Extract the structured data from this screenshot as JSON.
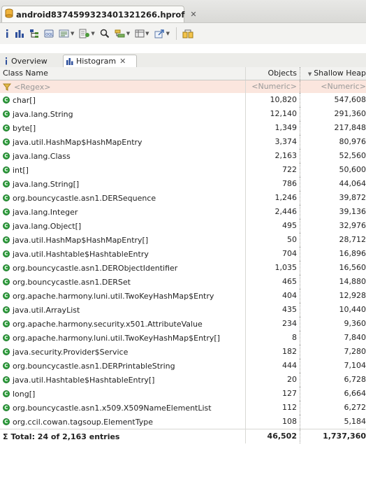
{
  "editor": {
    "file_tab": "android8374599323401321266.hprof",
    "close_glyph": "✕"
  },
  "toolbar": {
    "items": [
      {
        "name": "info-icon",
        "has_dropdown": false
      },
      {
        "name": "histogram-icon",
        "has_dropdown": false
      },
      {
        "name": "dominator-tree-icon",
        "has_dropdown": false
      },
      {
        "name": "oql-icon",
        "has_dropdown": false
      },
      {
        "name": "thread-overview-icon",
        "has_dropdown": true
      },
      {
        "name": "run-report-icon",
        "has_dropdown": true
      },
      {
        "name": "search-icon",
        "has_dropdown": false
      },
      {
        "name": "group-by-icon",
        "has_dropdown": true
      },
      {
        "name": "calculate-retained-icon",
        "has_dropdown": true
      },
      {
        "name": "export-icon",
        "has_dropdown": true
      },
      {
        "name": "compare-icon",
        "has_dropdown": false
      }
    ]
  },
  "subtabs": {
    "overview": "Overview",
    "histogram": "Histogram"
  },
  "table": {
    "headers": {
      "class_name": "Class Name",
      "objects": "Objects",
      "shallow_heap": "Shallow Heap"
    },
    "filter": {
      "regex": "<Regex>",
      "numeric_objects": "<Numeric>",
      "numeric_heap": "<Numeric>"
    },
    "rows": [
      {
        "name": "char[]",
        "objects": "10,820",
        "heap": "547,608"
      },
      {
        "name": "java.lang.String",
        "objects": "12,140",
        "heap": "291,360"
      },
      {
        "name": "byte[]",
        "objects": "1,349",
        "heap": "217,848"
      },
      {
        "name": "java.util.HashMap$HashMapEntry",
        "objects": "3,374",
        "heap": "80,976"
      },
      {
        "name": "java.lang.Class",
        "objects": "2,163",
        "heap": "52,560"
      },
      {
        "name": "int[]",
        "objects": "722",
        "heap": "50,600"
      },
      {
        "name": "java.lang.String[]",
        "objects": "786",
        "heap": "44,064"
      },
      {
        "name": "org.bouncycastle.asn1.DERSequence",
        "objects": "1,246",
        "heap": "39,872"
      },
      {
        "name": "java.lang.Integer",
        "objects": "2,446",
        "heap": "39,136"
      },
      {
        "name": "java.lang.Object[]",
        "objects": "495",
        "heap": "32,976"
      },
      {
        "name": "java.util.HashMap$HashMapEntry[]",
        "objects": "50",
        "heap": "28,712"
      },
      {
        "name": "java.util.Hashtable$HashtableEntry",
        "objects": "704",
        "heap": "16,896"
      },
      {
        "name": "org.bouncycastle.asn1.DERObjectIdentifier",
        "objects": "1,035",
        "heap": "16,560"
      },
      {
        "name": "org.bouncycastle.asn1.DERSet",
        "objects": "465",
        "heap": "14,880"
      },
      {
        "name": "org.apache.harmony.luni.util.TwoKeyHashMap$Entry",
        "objects": "404",
        "heap": "12,928"
      },
      {
        "name": "java.util.ArrayList",
        "objects": "435",
        "heap": "10,440"
      },
      {
        "name": "org.apache.harmony.security.x501.AttributeValue",
        "objects": "234",
        "heap": "9,360"
      },
      {
        "name": "org.apache.harmony.luni.util.TwoKeyHashMap$Entry[]",
        "objects": "8",
        "heap": "7,840"
      },
      {
        "name": "java.security.Provider$Service",
        "objects": "182",
        "heap": "7,280"
      },
      {
        "name": "org.bouncycastle.asn1.DERPrintableString",
        "objects": "444",
        "heap": "7,104"
      },
      {
        "name": "java.util.Hashtable$HashtableEntry[]",
        "objects": "20",
        "heap": "6,728"
      },
      {
        "name": "long[]",
        "objects": "127",
        "heap": "6,664"
      },
      {
        "name": "org.bouncycastle.asn1.x509.X509NameElementList",
        "objects": "112",
        "heap": "6,272"
      },
      {
        "name": "org.ccil.cowan.tagsoup.ElementType",
        "objects": "108",
        "heap": "5,184"
      }
    ],
    "total": {
      "label": "Total: 24 of 2,163 entries",
      "objects": "46,502",
      "heap": "1,737,360"
    }
  }
}
